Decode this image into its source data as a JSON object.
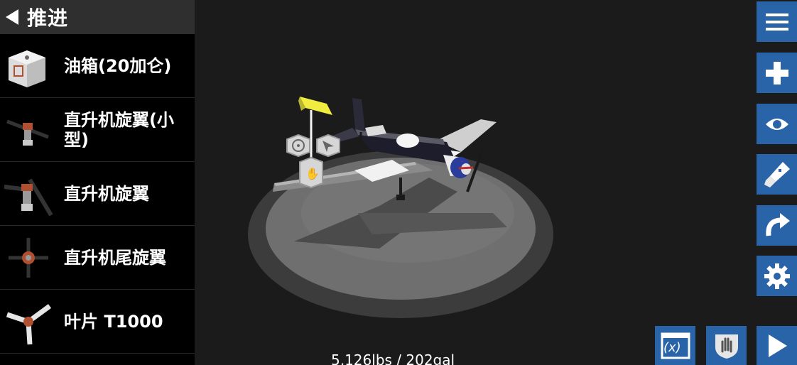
{
  "panel": {
    "title": "推进",
    "items": [
      {
        "label": "油箱(20加仑)",
        "icon": "fuel-tank-icon"
      },
      {
        "label": "直升机旋翼(小型)",
        "icon": "small-rotor-icon"
      },
      {
        "label": "直升机旋翼",
        "icon": "rotor-icon"
      },
      {
        "label": "直升机尾旋翼",
        "icon": "tail-rotor-icon"
      },
      {
        "label": "叶片 T1000",
        "icon": "propeller-icon"
      }
    ]
  },
  "toolbar": {
    "buttons": [
      {
        "name": "menu-button",
        "icon": "hamburger-icon"
      },
      {
        "name": "add-part-button",
        "icon": "plus-icon"
      },
      {
        "name": "view-button",
        "icon": "eye-icon"
      },
      {
        "name": "paint-button",
        "icon": "paintbrush-icon"
      },
      {
        "name": "undo-button",
        "icon": "curved-arrow-icon"
      },
      {
        "name": "settings-button",
        "icon": "gear-icon"
      }
    ],
    "bottom": [
      {
        "name": "variables-button",
        "icon": "function-x-icon",
        "text": "(x)"
      },
      {
        "name": "grab-mode-button",
        "icon": "hand-shield-icon"
      },
      {
        "name": "play-button",
        "icon": "play-icon"
      }
    ]
  },
  "stats": {
    "text": "5,126lbs / 202gal"
  },
  "colors": {
    "accent": "#2a64a8",
    "panel": "#000000",
    "header": "#2f2f2f"
  }
}
